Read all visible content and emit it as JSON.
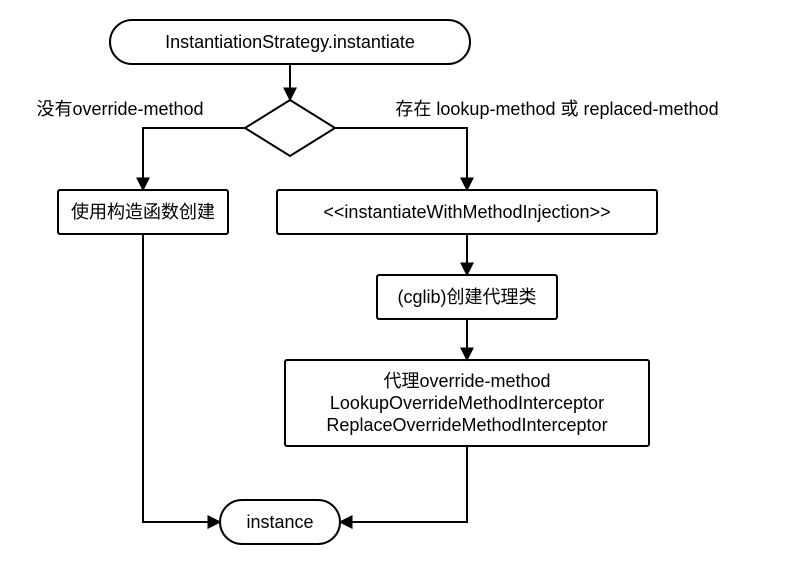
{
  "chart_data": {
    "type": "flowchart",
    "nodes": [
      {
        "id": "start",
        "type": "terminator",
        "label": "InstantiationStrategy.instantiate"
      },
      {
        "id": "decision",
        "type": "decision",
        "label": ""
      },
      {
        "id": "left1",
        "type": "process",
        "label": "使用构造函数创建"
      },
      {
        "id": "right1",
        "type": "process",
        "label": "<<instantiateWithMethodInjection>>"
      },
      {
        "id": "right2",
        "type": "process",
        "label": "(cglib)创建代理类"
      },
      {
        "id": "right3",
        "type": "process",
        "label": [
          "代理override-method",
          "LookupOverrideMethodInterceptor",
          "ReplaceOverrideMethodInterceptor"
        ]
      },
      {
        "id": "end",
        "type": "terminator",
        "label": "instance"
      }
    ],
    "edges": [
      {
        "from": "start",
        "to": "decision",
        "label": ""
      },
      {
        "from": "decision",
        "to": "left1",
        "label": "没有override-method"
      },
      {
        "from": "decision",
        "to": "right1",
        "label": "存在 lookup-method 或 replaced-method"
      },
      {
        "from": "right1",
        "to": "right2",
        "label": ""
      },
      {
        "from": "right2",
        "to": "right3",
        "label": ""
      },
      {
        "from": "left1",
        "to": "end",
        "label": ""
      },
      {
        "from": "right3",
        "to": "end",
        "label": ""
      }
    ]
  },
  "nodes": {
    "start": "InstantiationStrategy.instantiate",
    "left1": "使用构造函数创建",
    "right1": "<<instantiateWithMethodInjection>>",
    "right2": "(cglib)创建代理类",
    "right3_l1": "代理override-method",
    "right3_l2": "LookupOverrideMethodInterceptor",
    "right3_l3": "ReplaceOverrideMethodInterceptor",
    "end": "instance"
  },
  "edges": {
    "left_label": "没有override-method",
    "right_label_a": "存在 lookup-method 或",
    "right_label_b": "replaced-method"
  }
}
